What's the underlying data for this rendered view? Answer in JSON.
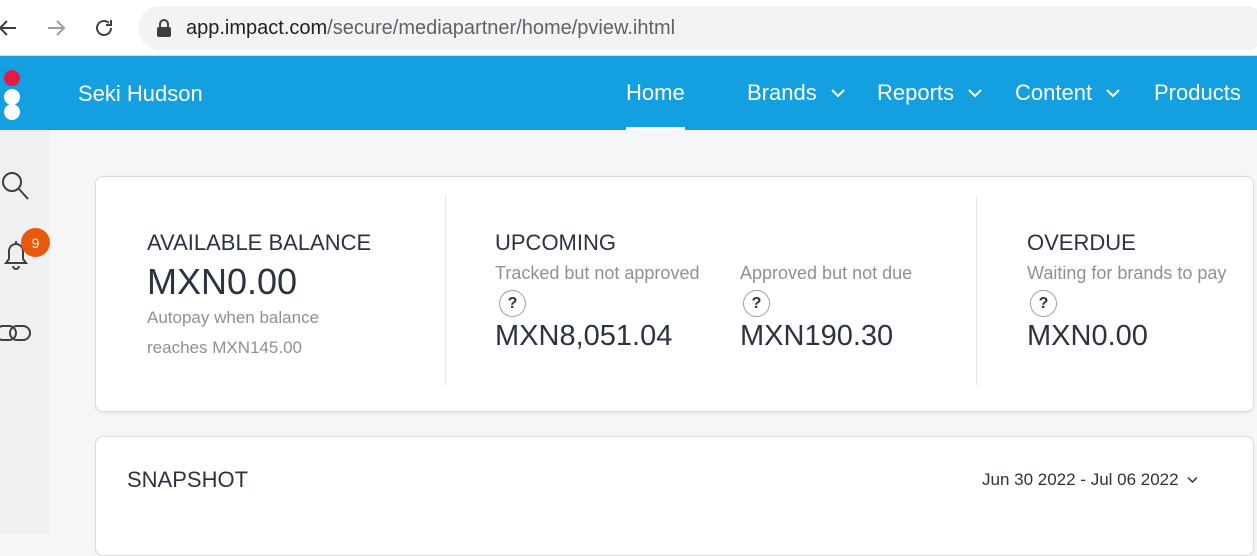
{
  "browser": {
    "url_host": "app.impact.com",
    "url_path": "/secure/mediapartner/home/pview.ihtml",
    "icons": [
      "back-arrow-icon",
      "forward-arrow-icon",
      "reload-icon",
      "lock-icon"
    ]
  },
  "header": {
    "account_name": "Seki Hudson",
    "nav": [
      {
        "label": "Home",
        "active": true
      },
      {
        "label": "Brands",
        "dropdown": true
      },
      {
        "label": "Reports",
        "dropdown": true
      },
      {
        "label": "Content",
        "dropdown": true
      },
      {
        "label": "Products"
      }
    ],
    "colors": {
      "bar": "#149fe0",
      "logo_dot": "#e8174a"
    }
  },
  "sidebar": {
    "icons": [
      "search-icon",
      "bell-icon",
      "link-icon"
    ],
    "notification_count": "9"
  },
  "balance": {
    "available": {
      "title": "AVAILABLE BALANCE",
      "amount": "MXN0.00",
      "note_line1": "Autopay when balance",
      "note_line2": "reaches MXN145.00"
    },
    "upcoming": {
      "title": "UPCOMING",
      "tracked": {
        "label": "Tracked but not approved",
        "help": "?",
        "amount": "MXN8,051.04"
      },
      "approved": {
        "label": "Approved but not due",
        "help": "?",
        "amount": "MXN190.30"
      }
    },
    "overdue": {
      "title": "OVERDUE",
      "label": "Waiting for brands to pay",
      "help": "?",
      "amount": "MXN0.00"
    }
  },
  "snapshot": {
    "title": "SNAPSHOT",
    "date_range": "Jun 30 2022 - Jul 06 2022"
  }
}
